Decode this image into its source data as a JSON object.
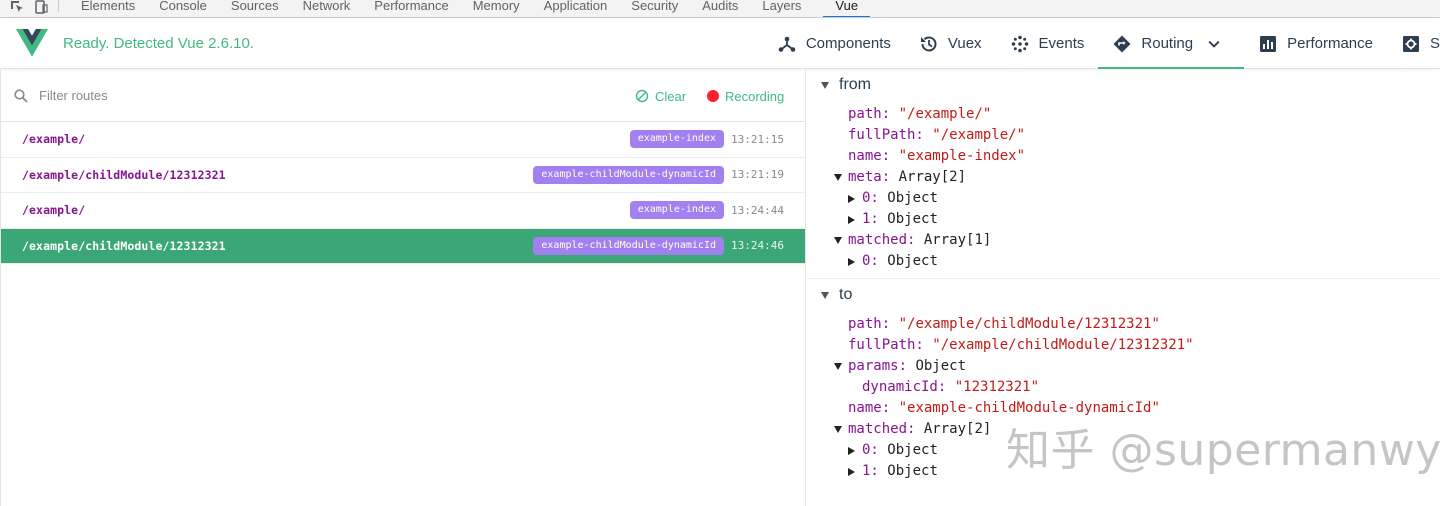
{
  "devtools": {
    "tabs": [
      "Elements",
      "Console",
      "Sources",
      "Network",
      "Performance",
      "Memory",
      "Application",
      "Security",
      "Audits",
      "Layers",
      "Vue"
    ],
    "active_tab": "Vue"
  },
  "header": {
    "status": "Ready. Detected Vue 2.6.10.",
    "nav": [
      {
        "label": "Components",
        "icon": "components-icon"
      },
      {
        "label": "Vuex",
        "icon": "history-icon"
      },
      {
        "label": "Events",
        "icon": "events-icon"
      },
      {
        "label": "Routing",
        "icon": "routing-icon"
      },
      {
        "label": "Performance",
        "icon": "performance-icon"
      },
      {
        "label": "S",
        "icon": "settings-icon"
      }
    ],
    "active_nav": "Routing",
    "brand_color": "#42b983"
  },
  "filter": {
    "placeholder": "Filter routes",
    "clear_label": "Clear",
    "recording_label": "Recording"
  },
  "routes": [
    {
      "path": "/example/",
      "name": "example-index",
      "time": "13:21:15",
      "selected": false
    },
    {
      "path": "/example/childModule/12312321",
      "name": "example-childModule-dynamicId",
      "time": "13:21:19",
      "selected": false
    },
    {
      "path": "/example/",
      "name": "example-index",
      "time": "13:24:44",
      "selected": false
    },
    {
      "path": "/example/childModule/12312321",
      "name": "example-childModule-dynamicId",
      "time": "13:24:46",
      "selected": true
    }
  ],
  "inspector": {
    "from": {
      "title": "from",
      "path_key": "path:",
      "path_val": "\"/example/\"",
      "fullpath_key": "fullPath:",
      "fullpath_val": "\"/example/\"",
      "name_key": "name:",
      "name_val": "\"example-index\"",
      "meta_key": "meta:",
      "meta_val": "Array[2]",
      "meta_0_key": "0:",
      "meta_0_val": "Object",
      "meta_1_key": "1:",
      "meta_1_val": "Object",
      "matched_key": "matched:",
      "matched_val": "Array[1]",
      "matched_0_key": "0:",
      "matched_0_val": "Object"
    },
    "to": {
      "title": "to",
      "path_key": "path:",
      "path_val": "\"/example/childModule/12312321\"",
      "fullpath_key": "fullPath:",
      "fullpath_val": "\"/example/childModule/12312321\"",
      "params_key": "params:",
      "params_val": "Object",
      "dynamic_key": "dynamicId:",
      "dynamic_val": "\"12312321\"",
      "name_key": "name:",
      "name_val": "\"example-childModule-dynamicId\"",
      "matched_key": "matched:",
      "matched_val": "Array[2]",
      "matched_0_key": "0:",
      "matched_0_val": "Object",
      "matched_1_key": "1:",
      "matched_1_val": "Object"
    }
  },
  "watermark": "知乎 @supermanwy"
}
